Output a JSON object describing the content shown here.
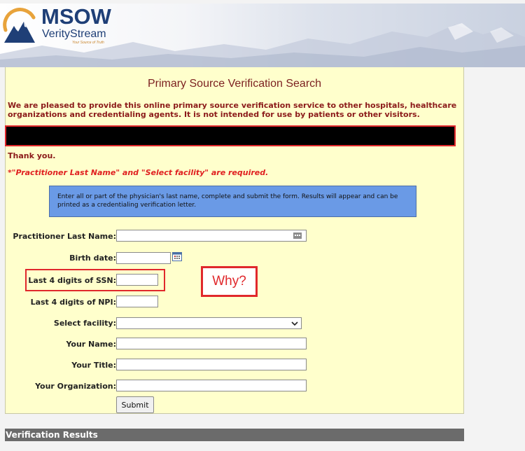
{
  "header": {
    "brand": "MSOW",
    "brand_sub": "VerityStream",
    "tagline": "Your Source of Truth"
  },
  "page": {
    "title": "Primary Source Verification Search",
    "intro": "We are pleased to provide this online primary source verification service to other hospitals, healthcare organizations and credentialing agents. It is not intended for use by patients or other visitors.",
    "thanks": "Thank you.",
    "required_note": "*\"Practitioner Last Name\" and \"Select facility\" are required.",
    "info_text": "Enter all or part of the physician's last name, complete and submit the form. Results will appear and can be printed as a credentialing verification letter."
  },
  "form": {
    "last_name_label": "Practitioner Last Name:",
    "last_name_value": "",
    "birth_date_label": "Birth date:",
    "birth_date_value": "",
    "ssn_label": "Last 4 digits of SSN:",
    "ssn_value": "",
    "npi_label": "Last 4 digits of NPI:",
    "npi_value": "",
    "facility_label": "Select facility:",
    "facility_value": "",
    "your_name_label": "Your Name:",
    "your_name_value": "",
    "your_title_label": "Your Title:",
    "your_title_value": "",
    "your_org_label": "Your Organization:",
    "your_org_value": "",
    "submit_label": "Submit"
  },
  "annotation": {
    "why_text": "Why?"
  },
  "results": {
    "heading": "Verification Results"
  },
  "colors": {
    "panel_bg": "#ffffcc",
    "intro_text": "#8b1a1a",
    "required_text": "#e02020",
    "info_bg": "#6a9ae6",
    "highlight_red": "#e0282c",
    "results_bar": "#6b6b6b"
  }
}
